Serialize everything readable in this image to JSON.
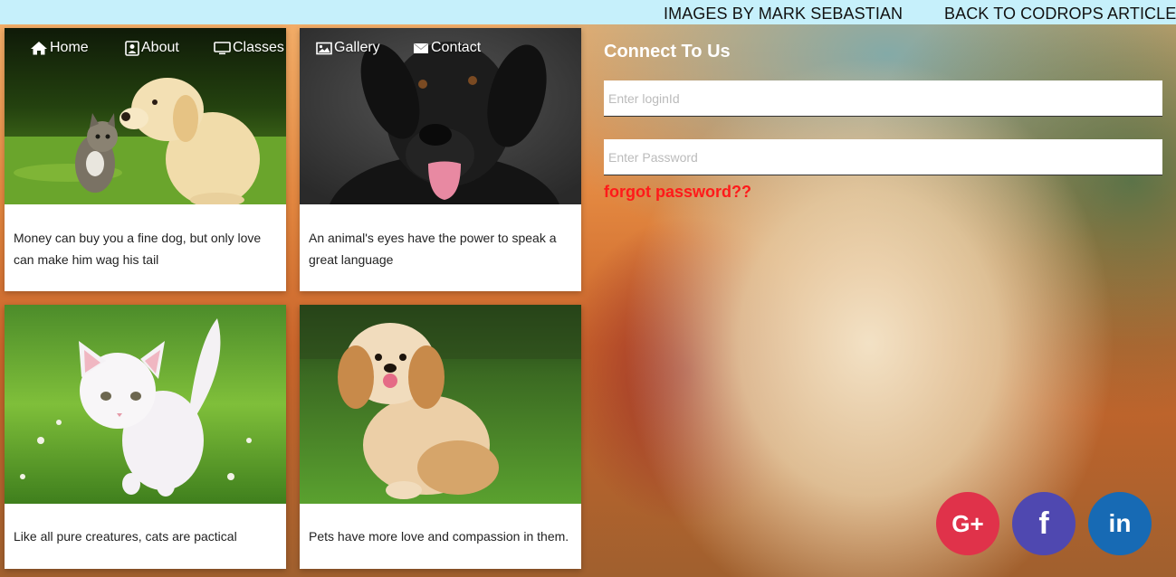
{
  "topbar": {
    "images_by": "IMAGES BY MARK SEBASTIAN",
    "back_link": "BACK TO CODROPS ARTICLE"
  },
  "nav": {
    "home": "Home",
    "about": "About",
    "classes": "Classes",
    "gallery": "Gallery",
    "contact": "Contact"
  },
  "cards": [
    {
      "caption": "Money can buy you a fine dog, but only love can make him wag his tail"
    },
    {
      "caption": "An animal's eyes have the power to speak a great language"
    },
    {
      "caption": "Like all pure creatures, cats are pactical"
    },
    {
      "caption": "Pets have more love and compassion in them."
    }
  ],
  "login": {
    "title": "Connect To Us",
    "login_placeholder": "Enter loginId",
    "password_placeholder": "Enter Password",
    "forgot": "forgot password??"
  },
  "social": {
    "google": "G+",
    "facebook": "f",
    "linkedin": "in"
  },
  "colors": {
    "topbar": "#c6f0fb",
    "forgot": "#ff1a1a",
    "google": "#e0324a",
    "facebook": "#4f48b0",
    "linkedin": "#176ab4"
  }
}
